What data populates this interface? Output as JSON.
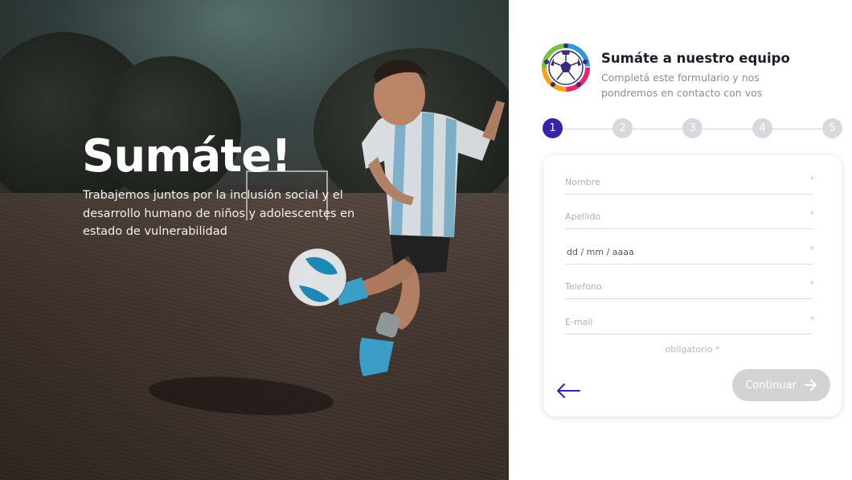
{
  "hero": {
    "title": "Sumáte!",
    "description": "Trabajemos juntos por la inclusión social y el desarrollo humano de niños y adolescentes en estado de vulnerabilidad"
  },
  "brand": {
    "title": "Sumáte a nuestro equipo",
    "subtitle": "Completá este formulario y nos pondremos en contacto con vos",
    "logo_icon": "soccer-ball-logo-icon"
  },
  "stepper": {
    "steps": [
      "1",
      "2",
      "3",
      "4",
      "5"
    ],
    "active_step": 1
  },
  "form": {
    "fields": [
      {
        "placeholder": "Nombre",
        "value": "",
        "required_mark": "*"
      },
      {
        "placeholder": "Apellido",
        "value": "",
        "required_mark": "*"
      },
      {
        "placeholder": "dd / mm / aaaa",
        "value": "",
        "required_mark": "*"
      },
      {
        "placeholder": "Telefono",
        "value": "",
        "required_mark": "*"
      },
      {
        "placeholder": "E-mail",
        "value": "",
        "required_mark": "*"
      }
    ],
    "required_note": "obligatorio *",
    "back_icon": "arrow-left-icon",
    "continue_label": "Continuar",
    "continue_icon": "arrow-right-icon"
  },
  "colors": {
    "accent": "#3a21a8",
    "step_inactive": "#d6d9dd",
    "button_disabled": "#d3d3d3"
  }
}
